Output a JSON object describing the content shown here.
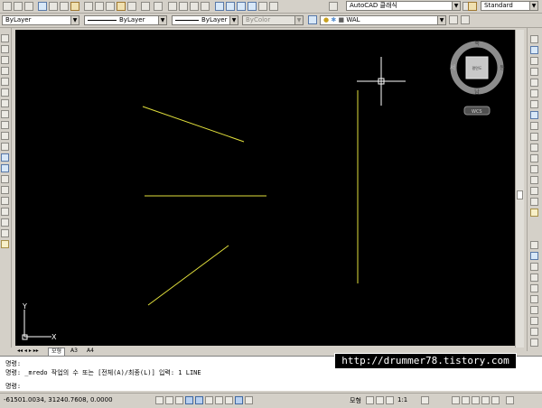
{
  "toolbar": {
    "workspace": "AutoCAD 클래식",
    "text_style": "Standard"
  },
  "properties": {
    "layer": "ByLayer",
    "linetype": "ByLayer",
    "lineweight": "ByLayer",
    "plotstyle": "ByColor",
    "current_layer": "WAL"
  },
  "viewcube": {
    "north": "북",
    "south": "남",
    "east": "동",
    "west": "서",
    "face": "평면도",
    "wcs": "WCS"
  },
  "ucs": {
    "x": "X",
    "y": "Y"
  },
  "tabs": {
    "model": "모형",
    "layout1": "A3",
    "layout2": "A4"
  },
  "command": {
    "line1": "명령:",
    "line2": "명령: _mredo 작업의 수 또는 [전체(A)/최종(L)] 입력: 1 LINE",
    "prompt": "명령:"
  },
  "watermark": "http://drummer78.tistory.com",
  "status": {
    "coords": "-61501.0034, 31240.7608, 0.0000",
    "model_label": "모형",
    "annotation_scale": "1:1"
  },
  "colors": {
    "canvas": "#000000",
    "line": "#e2e03c",
    "chrome": "#d4d0c8"
  }
}
